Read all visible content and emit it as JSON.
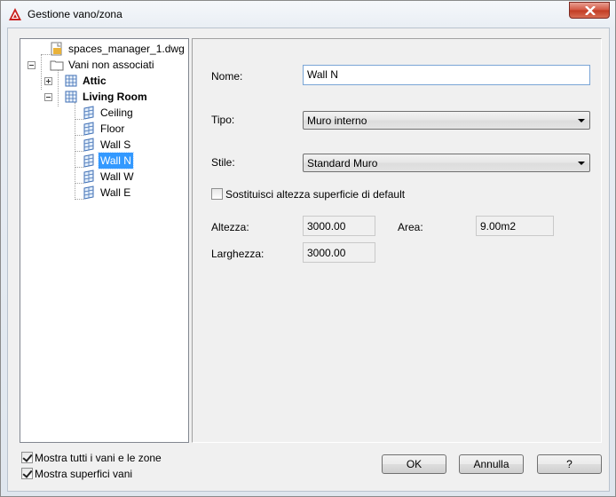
{
  "window": {
    "title": "Gestione vano/zona"
  },
  "tree": {
    "root": "spaces_manager_1.dwg",
    "group": "Vani non associati",
    "attic": "Attic",
    "living_room": "Living Room",
    "children": [
      "Ceiling",
      "Floor",
      "Wall S",
      "Wall N",
      "Wall W",
      "Wall E"
    ],
    "selected": "Wall N"
  },
  "form": {
    "name_label": "Nome:",
    "name_value": "Wall N",
    "type_label": "Tipo:",
    "type_value": "Muro interno",
    "style_label": "Stile:",
    "style_value": "Standard Muro",
    "override_label": "Sostituisci altezza superficie di default",
    "override_checked": false,
    "height_label": "Altezza:",
    "height_value": "3000.00",
    "area_label": "Area:",
    "area_value": "9.00m2",
    "width_label": "Larghezza:",
    "width_value": "3000.00"
  },
  "options": {
    "show_all_label": "Mostra tutti i vani e le zone",
    "show_all_checked": true,
    "show_surfaces_label": "Mostra superfici vani",
    "show_surfaces_checked": true
  },
  "buttons": {
    "ok": "OK",
    "cancel": "Annulla",
    "help": "?"
  },
  "icons": [
    "autocad-app-icon",
    "close-icon",
    "dwg-file-icon",
    "folder-icon",
    "space-icon",
    "surface-icon"
  ]
}
